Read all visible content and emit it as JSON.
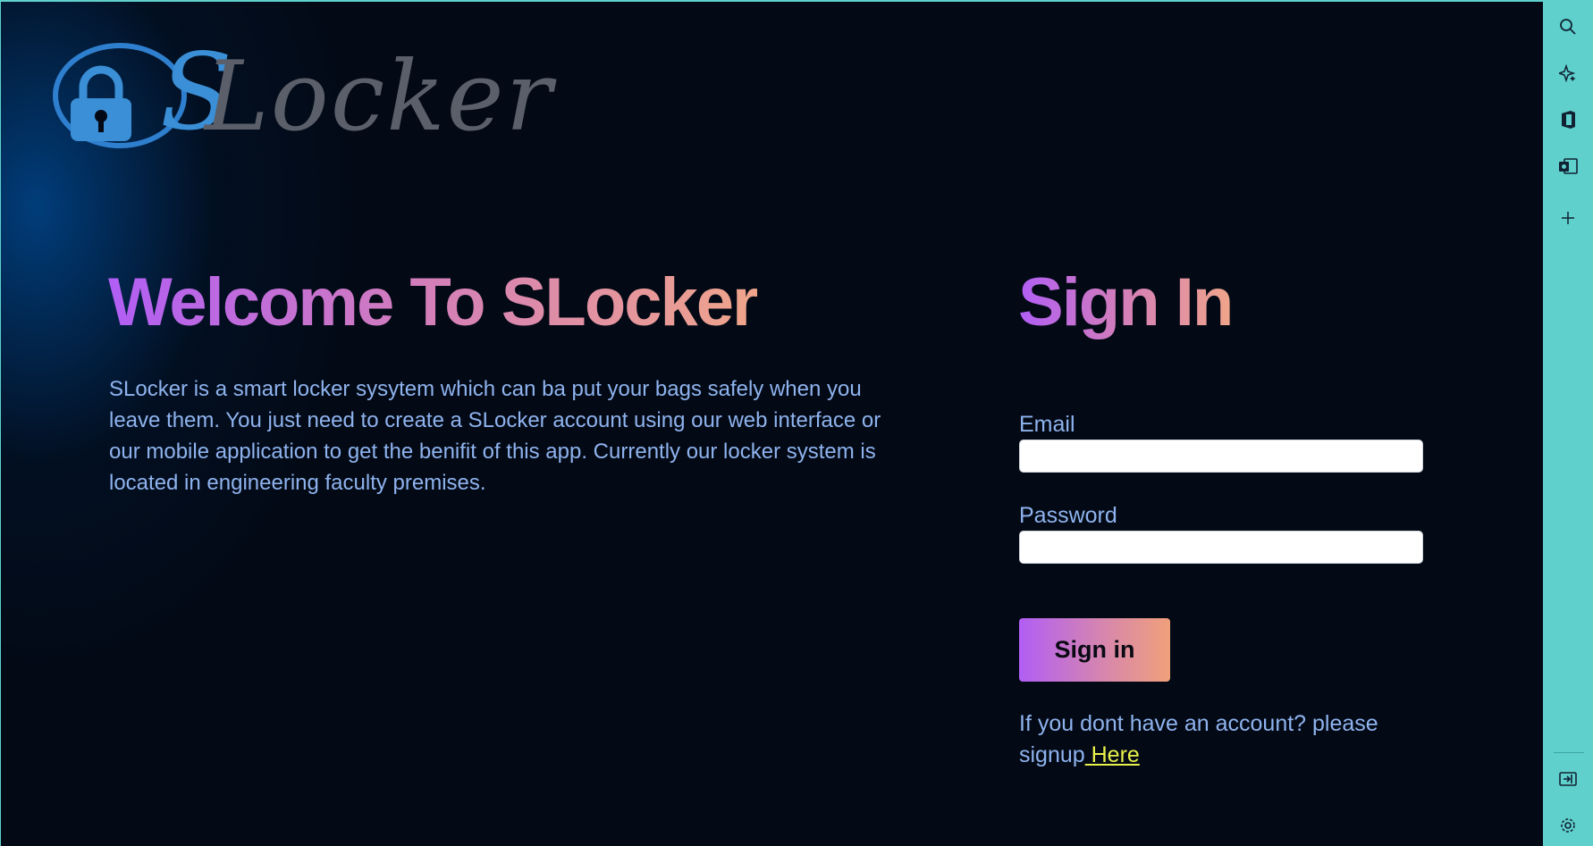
{
  "logo": {
    "s_letter": "S",
    "wordmark": "Locker"
  },
  "welcome": {
    "title": "Welcome To SLocker",
    "description": "SLocker is a smart locker sysytem which can ba put your bags safely when you leave them. You just need to create a SLocker account using our web interface or our mobile application to get the benifit of this app. Currently our locker system is located in engineering faculty premises."
  },
  "signin": {
    "title": "Sign In",
    "email_label": "Email",
    "email_value": "",
    "password_label": "Password",
    "password_value": "",
    "button_label": "Sign in",
    "signup_prompt": "If you dont have an account? please signup",
    "signup_link": " Here"
  },
  "sidebar": {
    "icons": [
      "search-icon",
      "sparkle-icon",
      "office-icon",
      "outlook-icon",
      "add-icon",
      "panel-icon",
      "settings-icon"
    ]
  },
  "colors": {
    "background": "#030a16",
    "accent_start": "#b15ef5",
    "accent_end": "#f0a58a",
    "text": "#8fb3ee",
    "link": "#e8f04a",
    "side_panel": "#5fd0cc"
  }
}
